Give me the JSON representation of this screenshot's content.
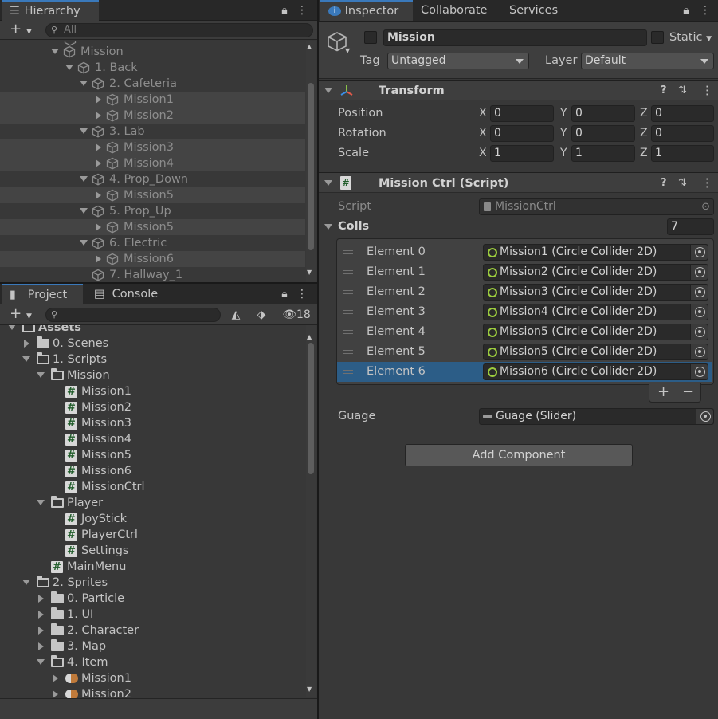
{
  "hierarchy": {
    "tab_label": "Hierarchy",
    "search_placeholder": "All",
    "rows": [
      {
        "label": "Mission",
        "kind": "go",
        "depth": 0,
        "arrow": "down",
        "alt": false
      },
      {
        "label": "1. Back",
        "kind": "go",
        "depth": 1,
        "arrow": "down",
        "alt": false
      },
      {
        "label": "2. Cafeteria",
        "kind": "go",
        "depth": 2,
        "arrow": "down",
        "alt": false
      },
      {
        "label": "Mission1",
        "kind": "go",
        "depth": 3,
        "arrow": "right",
        "alt": true
      },
      {
        "label": "Mission2",
        "kind": "go",
        "depth": 3,
        "arrow": "right",
        "alt": true
      },
      {
        "label": "3. Lab",
        "kind": "go",
        "depth": 2,
        "arrow": "down",
        "alt": false
      },
      {
        "label": "Mission3",
        "kind": "go",
        "depth": 3,
        "arrow": "right",
        "alt": true
      },
      {
        "label": "Mission4",
        "kind": "go",
        "depth": 3,
        "arrow": "right",
        "alt": true
      },
      {
        "label": "4. Prop_Down",
        "kind": "go",
        "depth": 2,
        "arrow": "down",
        "alt": false
      },
      {
        "label": "Mission5",
        "kind": "go",
        "depth": 3,
        "arrow": "right",
        "alt": true
      },
      {
        "label": "5. Prop_Up",
        "kind": "go",
        "depth": 2,
        "arrow": "down",
        "alt": false
      },
      {
        "label": "Mission5",
        "kind": "go",
        "depth": 3,
        "arrow": "right",
        "alt": true
      },
      {
        "label": "6. Electric",
        "kind": "go",
        "depth": 2,
        "arrow": "down",
        "alt": false
      },
      {
        "label": "Mission6",
        "kind": "go",
        "depth": 3,
        "arrow": "right",
        "alt": true
      },
      {
        "label": "7. Hallway_1",
        "kind": "go",
        "depth": 2,
        "arrow": "none",
        "alt": false
      }
    ]
  },
  "project": {
    "tab_project": "Project",
    "tab_console": "Console",
    "hidden_count": "18",
    "rows": [
      {
        "label": "Assets",
        "kind": "folder-open",
        "depth": 0,
        "arrow": "down"
      },
      {
        "label": "0. Scenes",
        "kind": "folder",
        "depth": 1,
        "arrow": "right"
      },
      {
        "label": "1. Scripts",
        "kind": "folder-open",
        "depth": 1,
        "arrow": "down"
      },
      {
        "label": "Mission",
        "kind": "folder-open",
        "depth": 2,
        "arrow": "down"
      },
      {
        "label": "Mission1",
        "kind": "script",
        "depth": 3,
        "arrow": "none"
      },
      {
        "label": "Mission2",
        "kind": "script",
        "depth": 3,
        "arrow": "none"
      },
      {
        "label": "Mission3",
        "kind": "script",
        "depth": 3,
        "arrow": "none"
      },
      {
        "label": "Mission4",
        "kind": "script",
        "depth": 3,
        "arrow": "none"
      },
      {
        "label": "Mission5",
        "kind": "script",
        "depth": 3,
        "arrow": "none"
      },
      {
        "label": "Mission6",
        "kind": "script",
        "depth": 3,
        "arrow": "none"
      },
      {
        "label": "MissionCtrl",
        "kind": "script",
        "depth": 3,
        "arrow": "none"
      },
      {
        "label": "Player",
        "kind": "folder-open",
        "depth": 2,
        "arrow": "down"
      },
      {
        "label": "JoyStick",
        "kind": "script",
        "depth": 3,
        "arrow": "none"
      },
      {
        "label": "PlayerCtrl",
        "kind": "script",
        "depth": 3,
        "arrow": "none"
      },
      {
        "label": "Settings",
        "kind": "script",
        "depth": 3,
        "arrow": "none"
      },
      {
        "label": "MainMenu",
        "kind": "script",
        "depth": 2,
        "arrow": "none"
      },
      {
        "label": "2. Sprites",
        "kind": "folder-open",
        "depth": 1,
        "arrow": "down"
      },
      {
        "label": "0. Particle",
        "kind": "folder",
        "depth": 2,
        "arrow": "right"
      },
      {
        "label": "1. UI",
        "kind": "folder",
        "depth": 2,
        "arrow": "right"
      },
      {
        "label": "2. Character",
        "kind": "folder",
        "depth": 2,
        "arrow": "right"
      },
      {
        "label": "3. Map",
        "kind": "folder",
        "depth": 2,
        "arrow": "right"
      },
      {
        "label": "4. Item",
        "kind": "folder-open",
        "depth": 2,
        "arrow": "down"
      },
      {
        "label": "Mission1",
        "kind": "sprite",
        "depth": 3,
        "arrow": "right"
      },
      {
        "label": "Mission2",
        "kind": "sprite",
        "depth": 3,
        "arrow": "right"
      }
    ]
  },
  "inspector": {
    "tabs": [
      "Inspector",
      "Collaborate",
      "Services"
    ],
    "object_name": "Mission",
    "static_label": "Static",
    "tag_label": "Tag",
    "tag_value": "Untagged",
    "layer_label": "Layer",
    "layer_value": "Default",
    "transform": {
      "title": "Transform",
      "rows": [
        {
          "label": "Position",
          "x": "0",
          "y": "0",
          "z": "0"
        },
        {
          "label": "Rotation",
          "x": "0",
          "y": "0",
          "z": "0"
        },
        {
          "label": "Scale",
          "x": "1",
          "y": "1",
          "z": "1"
        }
      ]
    },
    "script_comp": {
      "title": "Mission Ctrl (Script)",
      "script_label": "Script",
      "script_value": "MissionCtrl",
      "colls_label": "Colls",
      "colls_size": "7",
      "elements": [
        {
          "label": "Element 0",
          "value": "Mission1 (Circle Collider 2D)",
          "selected": false
        },
        {
          "label": "Element 1",
          "value": "Mission2 (Circle Collider 2D)",
          "selected": false
        },
        {
          "label": "Element 2",
          "value": "Mission3 (Circle Collider 2D)",
          "selected": false
        },
        {
          "label": "Element 3",
          "value": "Mission4 (Circle Collider 2D)",
          "selected": false
        },
        {
          "label": "Element 4",
          "value": "Mission5 (Circle Collider 2D)",
          "selected": false
        },
        {
          "label": "Element 5",
          "value": "Mission5 (Circle Collider 2D)",
          "selected": false
        },
        {
          "label": "Element 6",
          "value": "Mission6 (Circle Collider 2D)",
          "selected": true
        }
      ],
      "add_label": "+",
      "remove_label": "−",
      "guage_label": "Guage",
      "guage_value": "Guage (Slider)"
    },
    "add_component_label": "Add Component"
  },
  "colors": {
    "selection": "#2c5d87",
    "accent_tab": "#3a79bb",
    "collider_ring": "#9ccc3e"
  }
}
